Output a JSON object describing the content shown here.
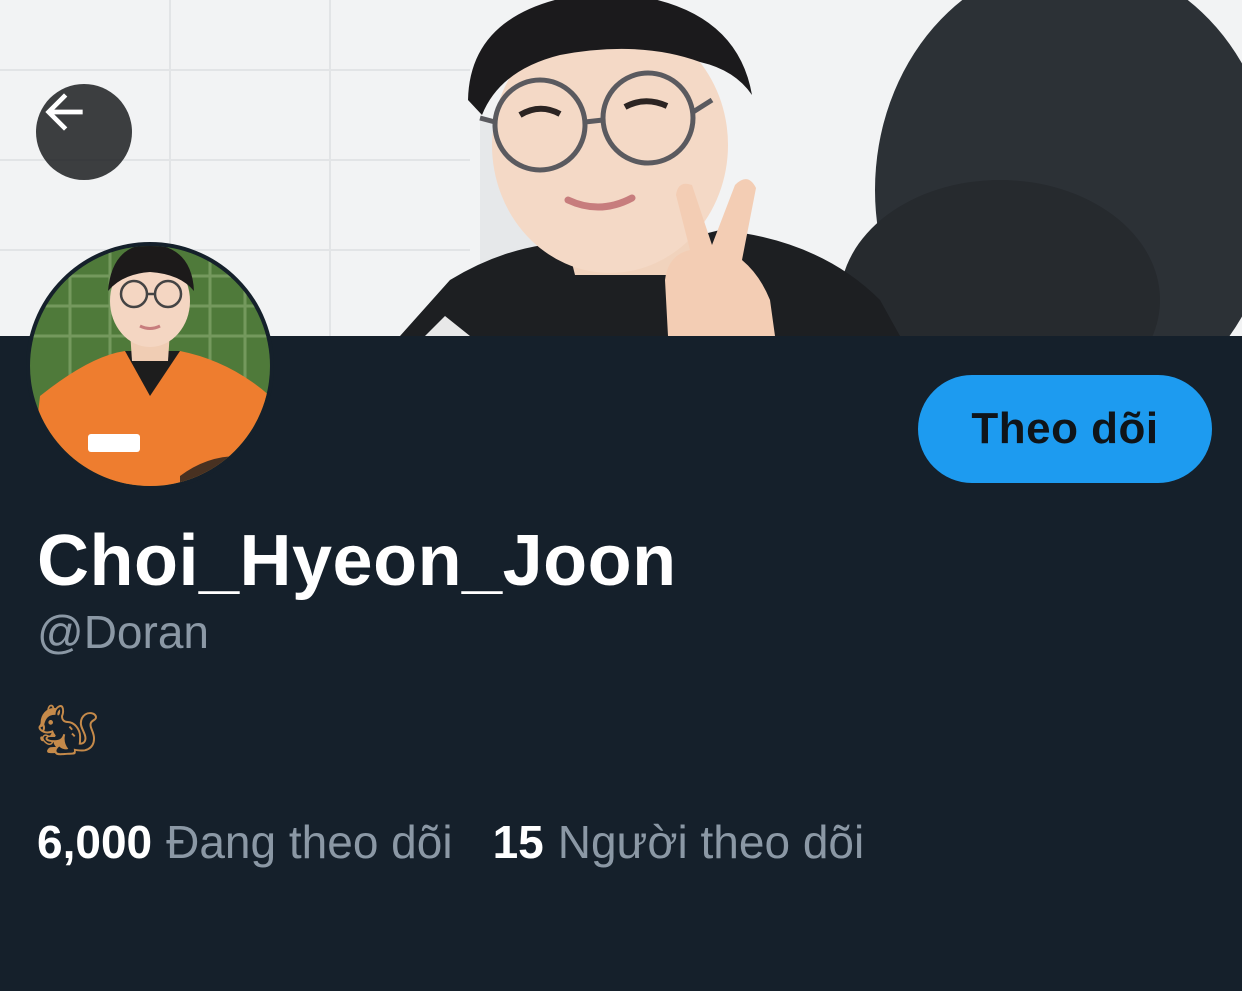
{
  "profile": {
    "display_name": "Choi_Hyeon_Joon",
    "handle": "@Doran",
    "bio": "🐿"
  },
  "actions": {
    "follow_label": "Theo dõi"
  },
  "stats": {
    "following_count": "6,000",
    "following_label": "Đang theo dõi",
    "followers_count": "15",
    "followers_label": "Người theo dõi"
  },
  "icons": {
    "back": "arrow-left-icon"
  },
  "colors": {
    "background": "#15202b",
    "accent": "#1d9bf0",
    "secondary_text": "#8b98a5",
    "primary_text": "#ffffff"
  }
}
